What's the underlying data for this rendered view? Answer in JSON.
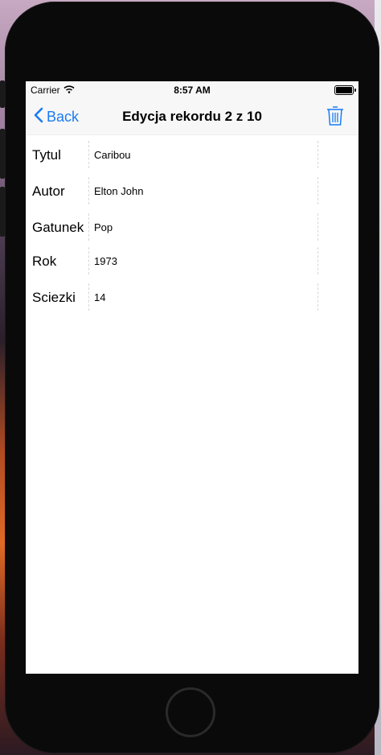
{
  "status": {
    "carrier": "Carrier",
    "time": "8:57 AM"
  },
  "nav": {
    "back_label": "Back",
    "title": "Edycja rekordu 2 z 10"
  },
  "fields": [
    {
      "label": "Tytul",
      "value": "Caribou"
    },
    {
      "label": "Autor",
      "value": "Elton John"
    },
    {
      "label": "Gatunek",
      "value": "Pop"
    },
    {
      "label": "Rok",
      "value": "1973"
    },
    {
      "label": "Sciezki",
      "value": "14"
    }
  ],
  "colors": {
    "accent": "#1a7cf5",
    "navbar_bg": "#f7f7f7"
  },
  "icons": {
    "back": "chevron-left-icon",
    "trash": "trash-icon",
    "wifi": "wifi-icon",
    "battery": "battery-icon"
  }
}
